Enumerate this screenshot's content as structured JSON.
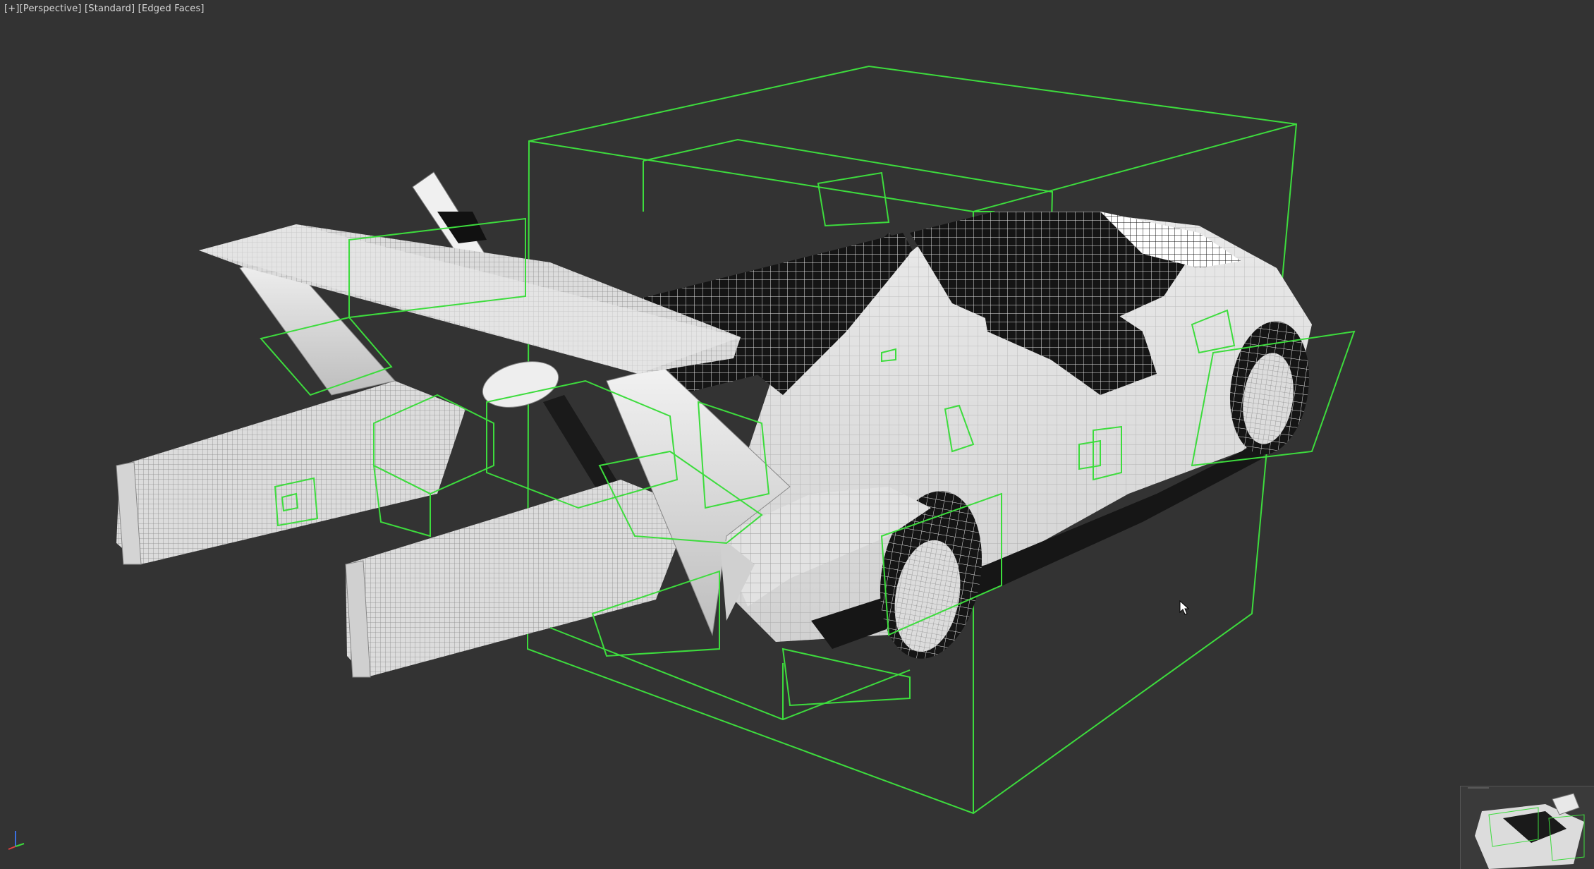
{
  "viewport": {
    "label": {
      "menu": "[+]",
      "view": "[Perspective]",
      "shading": "[Standard]",
      "display": "[Edged Faces]"
    }
  },
  "colors": {
    "background": "#333333",
    "bounding_box": "#3ddc3d",
    "model_surface": "#e4e4e4",
    "wire_edges": "#8a8a8a",
    "label_text": "#d8d8d8"
  },
  "icons": {
    "axis_gizmo": "xyz-axis-icon",
    "cursor": "mouse-pointer-icon",
    "thumbnail": "viewport-thumbnail"
  }
}
